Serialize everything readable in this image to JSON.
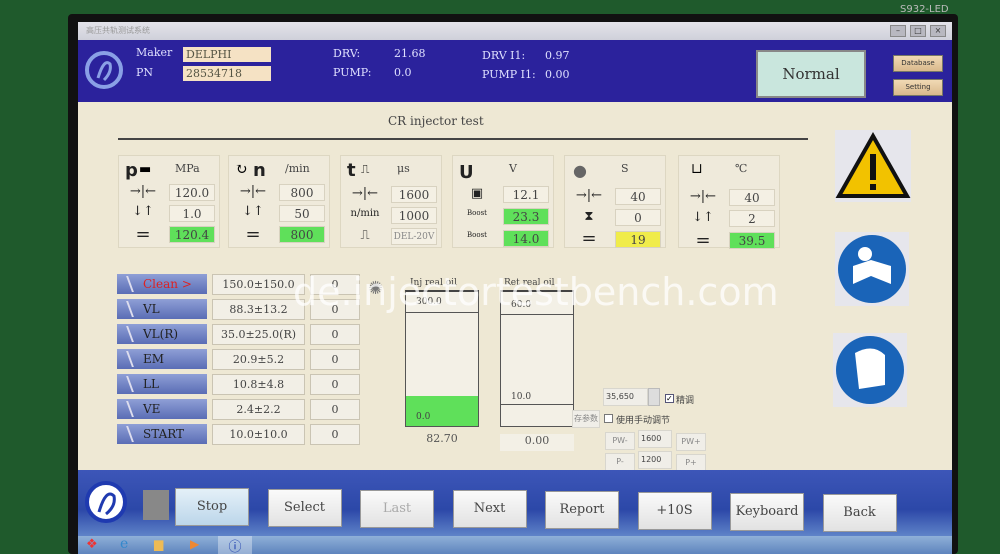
{
  "bezel_label": "S932-LED",
  "window": {
    "title": "高压共轨测试系统",
    "buttons": [
      "minimize",
      "maximize",
      "close"
    ]
  },
  "header": {
    "maker_label": "Maker",
    "maker": "DELPHI",
    "pn_label": "PN",
    "pn": "28534718",
    "drv_label": "DRV:",
    "drv": "21.68",
    "pump_label": "PUMP:",
    "pump": "0.0",
    "drv_i1_label": "DRV I1:",
    "drv_i1": "0.97",
    "pump_i1_label": "PUMP I1:",
    "pump_i1": "0.00",
    "status": "Normal",
    "database": "Database",
    "setting": "Setting"
  },
  "page_title": "CR injector test",
  "panels": [
    {
      "symbol": "p",
      "icon": "pressure-rail-icon",
      "unit": "MPa",
      "set": "120.0",
      "tol": "1.0",
      "actual": "120.4",
      "actual_color": "#5fe05a"
    },
    {
      "symbol": "n",
      "icon": "rotation-icon",
      "unit": "/min",
      "set": "800",
      "tol": "50",
      "actual": "800",
      "actual_color": "#5fe05a"
    },
    {
      "symbol": "t",
      "icon": "pulse-icon",
      "unit": "μs",
      "set": "1600",
      "rpm_label": "n/min",
      "rpm": "1000",
      "drive": "DEL-20V"
    },
    {
      "symbol": "U",
      "icon": "battery-icon",
      "unit": "V",
      "battery": "12.1",
      "boost1": "23.3",
      "boost2": "14.0",
      "boost_label": "Boost"
    },
    {
      "symbol": "",
      "icon": "clock-icon",
      "unit": "S",
      "set": "40",
      "elapsed": "0",
      "actual": "19",
      "actual_color": "#f0ec4a"
    },
    {
      "symbol": "",
      "icon": "oil-tank-icon",
      "unit": "℃",
      "set": "40",
      "tol": "2",
      "actual": "39.5",
      "actual_color": "#5fe05a"
    }
  ],
  "tests": [
    {
      "label": "Clean >",
      "spec": "150.0±150.0",
      "value": "0",
      "active": true
    },
    {
      "label": "VL",
      "spec": "88.3±13.2",
      "value": "0"
    },
    {
      "label": "VL(R)",
      "spec": "35.0±25.0(R)",
      "value": "0"
    },
    {
      "label": "EM",
      "spec": "20.9±5.2",
      "value": "0"
    },
    {
      "label": "LL",
      "spec": "10.8±4.8",
      "value": "0"
    },
    {
      "label": "VE",
      "spec": "2.4±2.2",
      "value": "0"
    },
    {
      "label": "START",
      "spec": "10.0±10.0",
      "value": "0"
    }
  ],
  "inj": {
    "label": "Inj real oil",
    "max": "300.0",
    "min": "0.0",
    "value": "82.70",
    "fill_fraction": 0.22
  },
  "ret": {
    "label": "Ret real oil",
    "max": "60.0",
    "min": "10.0",
    "value": "0.00"
  },
  "controls": {
    "spin": "35,650",
    "fine_label": "精调",
    "fine_checked": true,
    "save_label": "存参数",
    "manual_label": "使用手动调节",
    "manual_checked": false,
    "pw_minus": "PW-",
    "pw": "1600",
    "pw_plus": "PW+",
    "p_minus": "P-",
    "p": "1200",
    "p_plus": "P+"
  },
  "bottom": {
    "buttons": [
      "Stop",
      "Select",
      "Last",
      "Next",
      "Report",
      "+10S",
      "Keyboard",
      "Back"
    ]
  },
  "watermark": "de.injectortestbench.com"
}
